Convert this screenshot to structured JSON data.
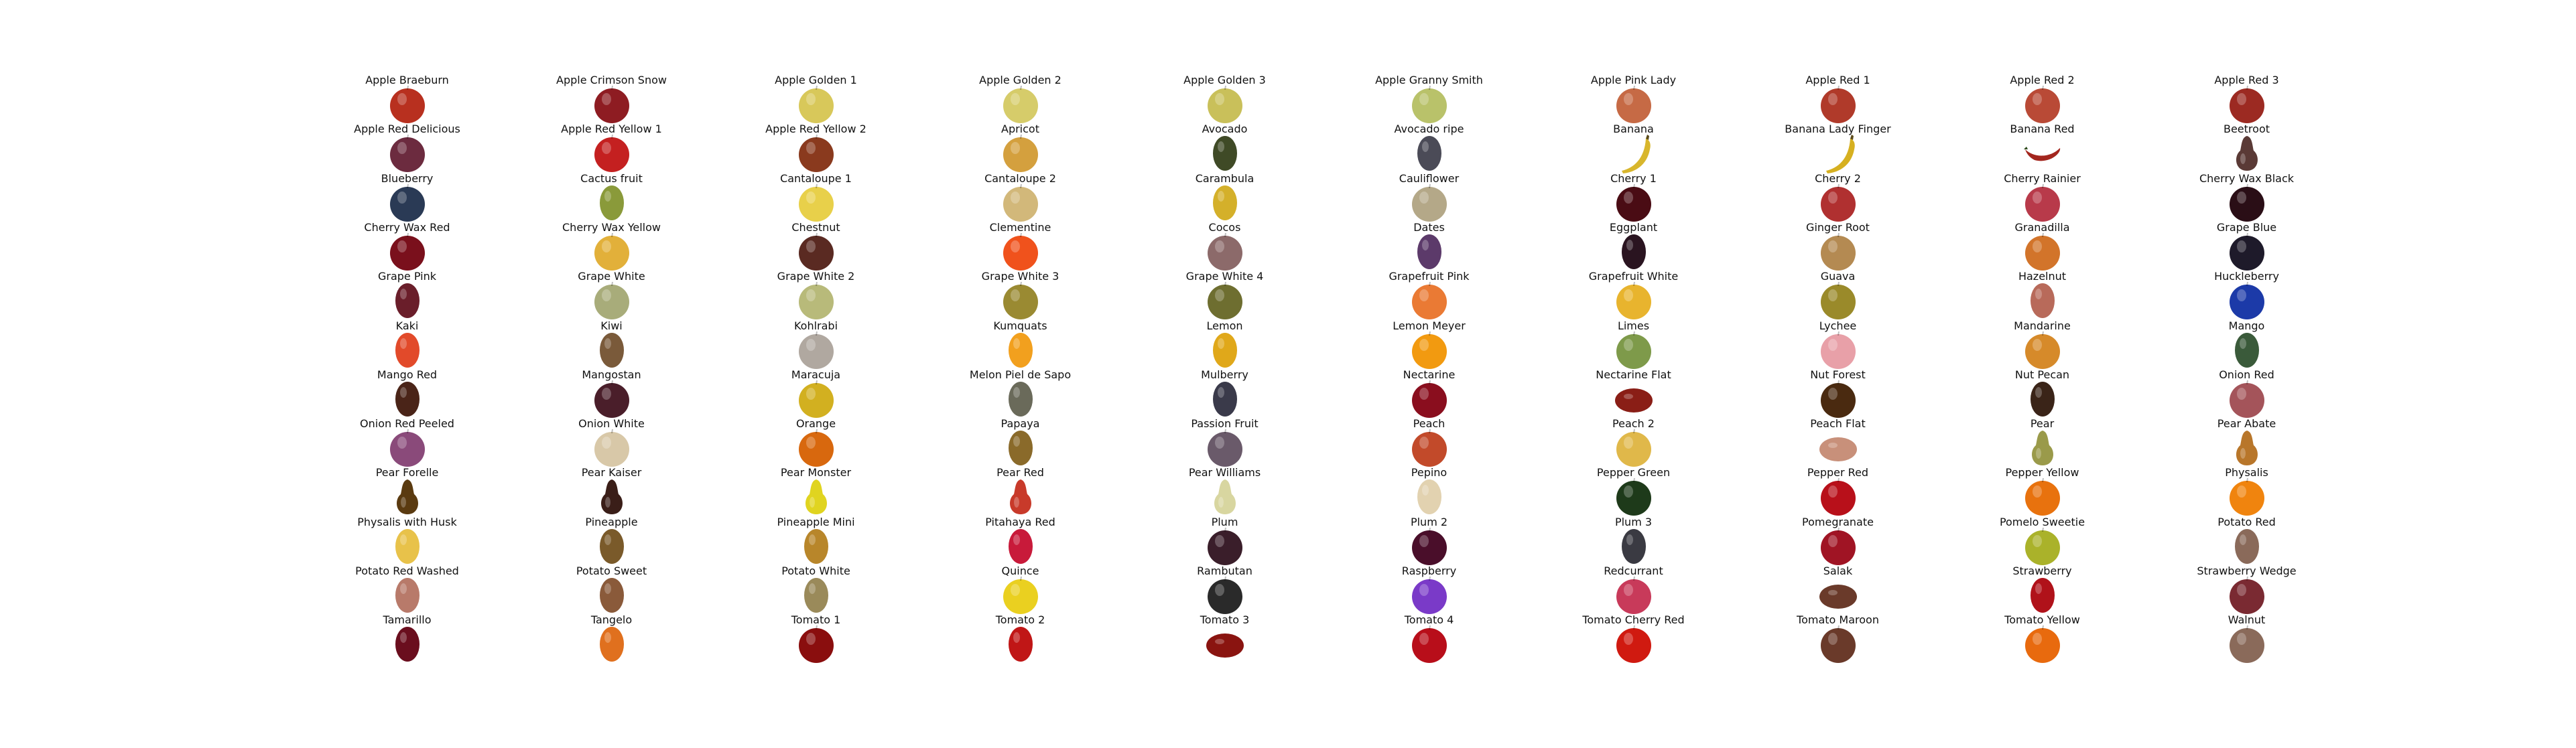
{
  "grid": {
    "columns": 10,
    "items": [
      {
        "label": "Apple Braeburn",
        "shape": "round",
        "color": "#b8301f"
      },
      {
        "label": "Apple Crimson Snow",
        "shape": "round",
        "color": "#8e1c22"
      },
      {
        "label": "Apple Golden 1",
        "shape": "round",
        "color": "#d8c85a"
      },
      {
        "label": "Apple Golden 2",
        "shape": "round",
        "color": "#d6cc6a"
      },
      {
        "label": "Apple Golden 3",
        "shape": "round",
        "color": "#c9c05a"
      },
      {
        "label": "Apple Granny Smith",
        "shape": "round",
        "color": "#b9c26a"
      },
      {
        "label": "Apple Pink Lady",
        "shape": "round",
        "color": "#c66a45"
      },
      {
        "label": "Apple Red 1",
        "shape": "round",
        "color": "#b03a2a"
      },
      {
        "label": "Apple Red 2",
        "shape": "round",
        "color": "#b94a36"
      },
      {
        "label": "Apple Red 3",
        "shape": "round",
        "color": "#9c2a22"
      },
      {
        "label": "Apple Red Delicious",
        "shape": "round",
        "color": "#6c2b3f"
      },
      {
        "label": "Apple Red Yellow 1",
        "shape": "round",
        "color": "#c42020"
      },
      {
        "label": "Apple Red Yellow 2",
        "shape": "round",
        "color": "#8a3a1e"
      },
      {
        "label": "Apricot",
        "shape": "round",
        "color": "#d4a03e"
      },
      {
        "label": "Avocado",
        "shape": "oval",
        "color": "#3f4a26"
      },
      {
        "label": "Avocado ripe",
        "shape": "oval",
        "color": "#4b4b57"
      },
      {
        "label": "Banana",
        "shape": "banana",
        "color": "#d8b62c"
      },
      {
        "label": "Banana Lady Finger",
        "shape": "banana",
        "color": "#d6b020"
      },
      {
        "label": "Banana Red",
        "shape": "pepper",
        "color": "#a3261e"
      },
      {
        "label": "Beetroot",
        "shape": "pear",
        "color": "#5a3a36"
      },
      {
        "label": "Blueberry",
        "shape": "round",
        "color": "#2a3a55"
      },
      {
        "label": "Cactus fruit",
        "shape": "oval",
        "color": "#8a9a3a"
      },
      {
        "label": "Cantaloupe 1",
        "shape": "round",
        "color": "#e8d04a"
      },
      {
        "label": "Cantaloupe 2",
        "shape": "round",
        "color": "#d2b87a"
      },
      {
        "label": "Carambula",
        "shape": "oval",
        "color": "#d4b02a"
      },
      {
        "label": "Cauliflower",
        "shape": "round",
        "color": "#b4a888"
      },
      {
        "label": "Cherry 1",
        "shape": "round",
        "color": "#4a0c14"
      },
      {
        "label": "Cherry 2",
        "shape": "round",
        "color": "#b03030"
      },
      {
        "label": "Cherry Rainier",
        "shape": "round",
        "color": "#b83a4a"
      },
      {
        "label": "Cherry Wax Black",
        "shape": "round",
        "color": "#2a0e16"
      },
      {
        "label": "Cherry Wax Red",
        "shape": "round",
        "color": "#7a101c"
      },
      {
        "label": "Cherry Wax Yellow",
        "shape": "round",
        "color": "#e2b03a"
      },
      {
        "label": "Chestnut",
        "shape": "round",
        "color": "#5a2a22"
      },
      {
        "label": "Clementine",
        "shape": "round",
        "color": "#f0521c"
      },
      {
        "label": "Cocos",
        "shape": "round",
        "color": "#8c6a6a"
      },
      {
        "label": "Dates",
        "shape": "oval",
        "color": "#5c3a6a"
      },
      {
        "label": "Eggplant",
        "shape": "oval",
        "color": "#2a1420"
      },
      {
        "label": "Ginger Root",
        "shape": "round",
        "color": "#b48a52"
      },
      {
        "label": "Granadilla",
        "shape": "round",
        "color": "#d2742a"
      },
      {
        "label": "Grape Blue",
        "shape": "round",
        "color": "#1e1a2a"
      },
      {
        "label": "Grape Pink",
        "shape": "oval",
        "color": "#6a1e2a"
      },
      {
        "label": "Grape White",
        "shape": "round",
        "color": "#a8ac7a"
      },
      {
        "label": "Grape White 2",
        "shape": "round",
        "color": "#b8ba7a"
      },
      {
        "label": "Grape White 3",
        "shape": "round",
        "color": "#9a8a32"
      },
      {
        "label": "Grape White 4",
        "shape": "round",
        "color": "#6e6e30"
      },
      {
        "label": "Grapefruit Pink",
        "shape": "round",
        "color": "#ea7a34"
      },
      {
        "label": "Grapefruit White",
        "shape": "round",
        "color": "#e8b42e"
      },
      {
        "label": "Guava",
        "shape": "round",
        "color": "#9a8a2a"
      },
      {
        "label": "Hazelnut",
        "shape": "oval",
        "color": "#b86a5a"
      },
      {
        "label": "Huckleberry",
        "shape": "round",
        "color": "#1c3aa8"
      },
      {
        "label": "Kaki",
        "shape": "oval",
        "color": "#e24a2a"
      },
      {
        "label": "Kiwi",
        "shape": "oval",
        "color": "#7a5a3a"
      },
      {
        "label": "Kohlrabi",
        "shape": "round",
        "color": "#b0a8a0"
      },
      {
        "label": "Kumquats",
        "shape": "oval",
        "color": "#f2a01e"
      },
      {
        "label": "Lemon",
        "shape": "oval",
        "color": "#e0a81a"
      },
      {
        "label": "Lemon Meyer",
        "shape": "round",
        "color": "#f29a10"
      },
      {
        "label": "Limes",
        "shape": "round",
        "color": "#7e9a4a"
      },
      {
        "label": "Lychee",
        "shape": "round",
        "color": "#e8a0a8"
      },
      {
        "label": "Mandarine",
        "shape": "round",
        "color": "#d68a2a"
      },
      {
        "label": "Mango",
        "shape": "oval",
        "color": "#3a5a3a"
      },
      {
        "label": "Mango Red",
        "shape": "oval",
        "color": "#4a2418"
      },
      {
        "label": "Mangostan",
        "shape": "round",
        "color": "#4a1e2a"
      },
      {
        "label": "Maracuja",
        "shape": "round",
        "color": "#d2b020"
      },
      {
        "label": "Melon Piel de Sapo",
        "shape": "oval",
        "color": "#6a6a5a"
      },
      {
        "label": "Mulberry",
        "shape": "oval",
        "color": "#3a3a4a"
      },
      {
        "label": "Nectarine",
        "shape": "round",
        "color": "#8a0e1e"
      },
      {
        "label": "Nectarine Flat",
        "shape": "flat",
        "color": "#8a1e16"
      },
      {
        "label": "Nut Forest",
        "shape": "round",
        "color": "#4a2a10"
      },
      {
        "label": "Nut Pecan",
        "shape": "oval",
        "color": "#3a2418"
      },
      {
        "label": "Onion Red",
        "shape": "round",
        "color": "#a4545a"
      },
      {
        "label": "Onion Red Peeled",
        "shape": "round",
        "color": "#8a4a7a"
      },
      {
        "label": "Onion White",
        "shape": "round",
        "color": "#d8c8a8"
      },
      {
        "label": "Orange",
        "shape": "round",
        "color": "#d8680e"
      },
      {
        "label": "Papaya",
        "shape": "oval",
        "color": "#8a6a2a"
      },
      {
        "label": "Passion Fruit",
        "shape": "round",
        "color": "#6a5a6a"
      },
      {
        "label": "Peach",
        "shape": "round",
        "color": "#c24a2a"
      },
      {
        "label": "Peach 2",
        "shape": "round",
        "color": "#e0b84a"
      },
      {
        "label": "Peach Flat",
        "shape": "flat",
        "color": "#c8907a"
      },
      {
        "label": "Pear",
        "shape": "pear",
        "color": "#9a9a4a"
      },
      {
        "label": "Pear Abate",
        "shape": "pear",
        "color": "#b8762a"
      },
      {
        "label": "Pear Forelle",
        "shape": "pear",
        "color": "#5a3a10"
      },
      {
        "label": "Pear Kaiser",
        "shape": "pear",
        "color": "#3a1e18"
      },
      {
        "label": "Pear Monster",
        "shape": "pear",
        "color": "#e0d420"
      },
      {
        "label": "Pear Red",
        "shape": "pear",
        "color": "#c83a2a"
      },
      {
        "label": "Pear Williams",
        "shape": "pear",
        "color": "#d8d6a0"
      },
      {
        "label": "Pepino",
        "shape": "oval",
        "color": "#e2d2b0"
      },
      {
        "label": "Pepper Green",
        "shape": "round",
        "color": "#1e3a1a"
      },
      {
        "label": "Pepper Red",
        "shape": "round",
        "color": "#b8101a"
      },
      {
        "label": "Pepper Yellow",
        "shape": "round",
        "color": "#e8720e"
      },
      {
        "label": "Physalis",
        "shape": "round",
        "color": "#f0840e"
      },
      {
        "label": "Physalis with Husk",
        "shape": "oval",
        "color": "#e8c24a"
      },
      {
        "label": "Pineapple",
        "shape": "oval",
        "color": "#7a5a2a"
      },
      {
        "label": "Pineapple Mini",
        "shape": "oval",
        "color": "#b8862a"
      },
      {
        "label": "Pitahaya Red",
        "shape": "oval",
        "color": "#c81a3a"
      },
      {
        "label": "Plum",
        "shape": "round",
        "color": "#3a1e2a"
      },
      {
        "label": "Plum 2",
        "shape": "round",
        "color": "#4a0e2a"
      },
      {
        "label": "Plum 3",
        "shape": "oval",
        "color": "#3a3a42"
      },
      {
        "label": "Pomegranate",
        "shape": "round",
        "color": "#a01424"
      },
      {
        "label": "Pomelo Sweetie",
        "shape": "round",
        "color": "#aab22a"
      },
      {
        "label": "Potato Red",
        "shape": "oval",
        "color": "#8a6a5a"
      },
      {
        "label": "Potato Red Washed",
        "shape": "oval",
        "color": "#b87a6a"
      },
      {
        "label": "Potato Sweet",
        "shape": "oval",
        "color": "#8a5a3a"
      },
      {
        "label": "Potato White",
        "shape": "oval",
        "color": "#9a8a5a"
      },
      {
        "label": "Quince",
        "shape": "round",
        "color": "#ead020"
      },
      {
        "label": "Rambutan",
        "shape": "round",
        "color": "#2a2a2a"
      },
      {
        "label": "Raspberry",
        "shape": "round",
        "color": "#7a3ac8"
      },
      {
        "label": "Redcurrant",
        "shape": "round",
        "color": "#c83a5a"
      },
      {
        "label": "Salak",
        "shape": "flat",
        "color": "#6a3a2a"
      },
      {
        "label": "Strawberry",
        "shape": "oval",
        "color": "#b0121a"
      },
      {
        "label": "Strawberry Wedge",
        "shape": "round",
        "color": "#7a2a32"
      },
      {
        "label": "Tamarillo",
        "shape": "oval",
        "color": "#6a0e1e"
      },
      {
        "label": "Tangelo",
        "shape": "oval",
        "color": "#e0701e"
      },
      {
        "label": "Tomato 1",
        "shape": "round",
        "color": "#8a0e0e"
      },
      {
        "label": "Tomato 2",
        "shape": "oval",
        "color": "#c01616"
      },
      {
        "label": "Tomato 3",
        "shape": "flat",
        "color": "#8a1410"
      },
      {
        "label": "Tomato 4",
        "shape": "round",
        "color": "#b80e1a"
      },
      {
        "label": "Tomato Cherry Red",
        "shape": "round",
        "color": "#d01a10"
      },
      {
        "label": "Tomato Maroon",
        "shape": "round",
        "color": "#6a3a2a"
      },
      {
        "label": "Tomato Yellow",
        "shape": "round",
        "color": "#e86a0e"
      },
      {
        "label": "Walnut",
        "shape": "round",
        "color": "#8a6a5a"
      }
    ]
  }
}
